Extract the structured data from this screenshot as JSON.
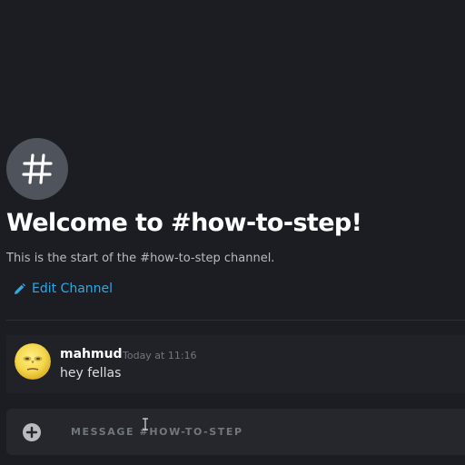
{
  "channel": {
    "hash_icon": "hash-icon",
    "welcome_title": "Welcome to #how-to-step!",
    "welcome_subtitle": "This is the start of the #how-to-step channel.",
    "edit_label": "Edit Channel",
    "edit_icon": "pencil-icon"
  },
  "messages": [
    {
      "author": "mahmud",
      "timestamp": "Today at 11:16",
      "text": "hey fellas",
      "avatar_icon": "moon-face-avatar"
    }
  ],
  "composer": {
    "placeholder": "MESSAGE #HOW-TO-STEP",
    "attach_icon": "plus-circle-icon"
  },
  "colors": {
    "background": "#1b1d22",
    "accent_link": "#2fa8e6",
    "message_bg": "#202227",
    "composer_bg": "#25272d",
    "hash_circle": "#4f545c"
  }
}
